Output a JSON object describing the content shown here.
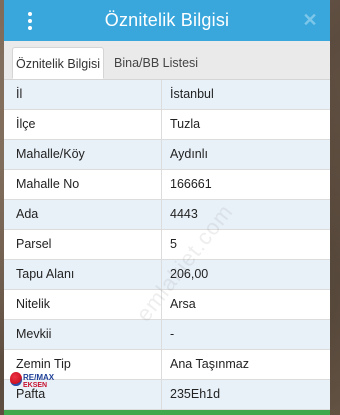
{
  "header": {
    "title": "Öznitelik Bilgisi",
    "menu_icon": "vertical-dots-icon",
    "close_icon": "close-icon"
  },
  "tabs": [
    {
      "label": "Öznitelik Bilgisi",
      "active": true
    },
    {
      "label": "Bina/BB Listesi",
      "active": false
    }
  ],
  "rows": [
    {
      "key": "İl",
      "value": "İstanbul"
    },
    {
      "key": "İlçe",
      "value": "Tuzla"
    },
    {
      "key": "Mahalle/Köy",
      "value": "Aydınlı"
    },
    {
      "key": "Mahalle No",
      "value": "166661"
    },
    {
      "key": "Ada",
      "value": "4443"
    },
    {
      "key": "Parsel",
      "value": "5"
    },
    {
      "key": "Tapu Alanı",
      "value": "206,00"
    },
    {
      "key": "Nitelik",
      "value": "Arsa"
    },
    {
      "key": "Mevkii",
      "value": "-"
    },
    {
      "key": "Zemin Tip",
      "value": "Ana Taşınmaz"
    },
    {
      "key": "Pafta",
      "value": "235Eh1d"
    }
  ],
  "watermark": "emlakjet.com",
  "logo": {
    "brand": "RE/MAX",
    "sub": "EKSEN"
  },
  "colors": {
    "header": "#39a7dc",
    "row_alt": "#e9f1f8",
    "footer_bar": "#3fa84a"
  }
}
